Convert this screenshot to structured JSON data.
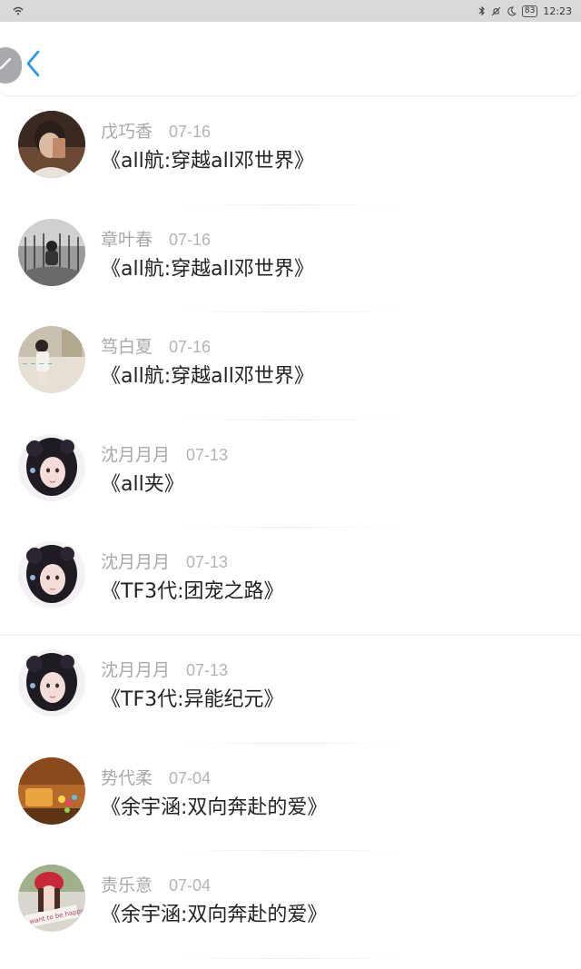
{
  "status_bar": {
    "time": "12:23",
    "battery": "83"
  },
  "header": {
    "back_icon": "chevron-left-icon",
    "edit_icon": "pencil-icon"
  },
  "list": [
    {
      "author": "戊巧香",
      "date": "07-16",
      "title": "《all航:穿越all邓世界》"
    },
    {
      "author": "章叶春",
      "date": "07-16",
      "title": "《all航:穿越all邓世界》"
    },
    {
      "author": "笃白夏",
      "date": "07-16",
      "title": "《all航:穿越all邓世界》"
    },
    {
      "author": "沈月月月",
      "date": "07-13",
      "title": "《all夹》"
    },
    {
      "author": "沈月月月",
      "date": "07-13",
      "title": "《TF3代:团宠之路》"
    },
    {
      "author": "沈月月月",
      "date": "07-13",
      "title": "《TF3代:异能纪元》"
    },
    {
      "author": "势代柔",
      "date": "07-04",
      "title": "《余宇涵:双向奔赴的爱》"
    },
    {
      "author": "责乐意",
      "date": "07-04",
      "title": "《余宇涵:双向奔赴的爱》"
    }
  ],
  "colors": {
    "accent": "#2196f3",
    "status_bar_bg": "#d9d9d9",
    "author_text": "#a8a8a8",
    "title_text": "#222222"
  }
}
